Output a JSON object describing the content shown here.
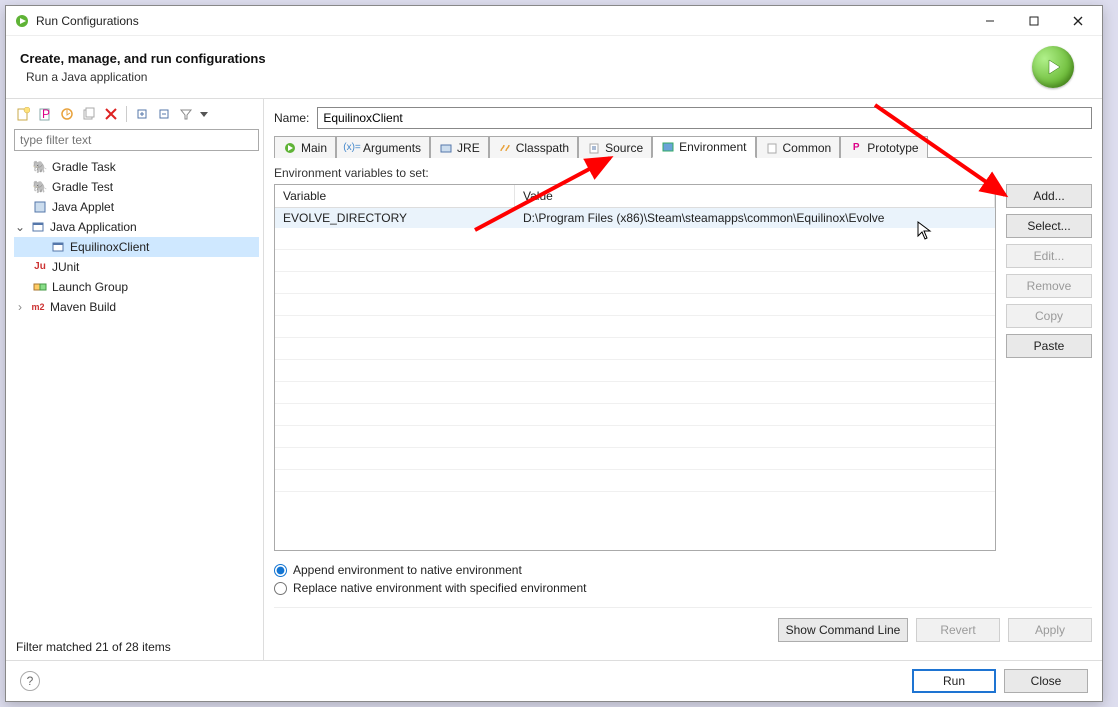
{
  "window": {
    "title": "Run Configurations"
  },
  "header": {
    "title": "Create, manage, and run configurations",
    "subtitle": "Run a Java application"
  },
  "filter": {
    "placeholder": "type filter text"
  },
  "tree": {
    "items": [
      {
        "label": "Gradle Task"
      },
      {
        "label": "Gradle Test"
      },
      {
        "label": "Java Applet"
      },
      {
        "label": "Java Application"
      },
      {
        "label": "EquilinoxClient"
      },
      {
        "label": "JUnit"
      },
      {
        "label": "Launch Group"
      },
      {
        "label": "Maven Build"
      }
    ],
    "status": "Filter matched 21 of 28 items"
  },
  "name": {
    "label": "Name:",
    "value": "EquilinoxClient"
  },
  "tabs": {
    "main": "Main",
    "arguments": "Arguments",
    "jre": "JRE",
    "classpath": "Classpath",
    "source": "Source",
    "environment": "Environment",
    "common": "Common",
    "prototype": "Prototype"
  },
  "env": {
    "label": "Environment variables to set:",
    "header_variable": "Variable",
    "header_value": "Value",
    "rows": [
      {
        "variable": "EVOLVE_DIRECTORY",
        "value": "D:\\Program Files (x86)\\Steam\\steamapps\\common\\Equilinox\\Evolve"
      }
    ],
    "radio_append": "Append environment to native environment",
    "radio_replace": "Replace native environment with specified environment"
  },
  "buttons": {
    "add": "Add...",
    "select": "Select...",
    "edit": "Edit...",
    "remove": "Remove",
    "copy": "Copy",
    "paste": "Paste",
    "show_cmd": "Show Command Line",
    "revert": "Revert",
    "apply": "Apply",
    "run": "Run",
    "close": "Close"
  }
}
